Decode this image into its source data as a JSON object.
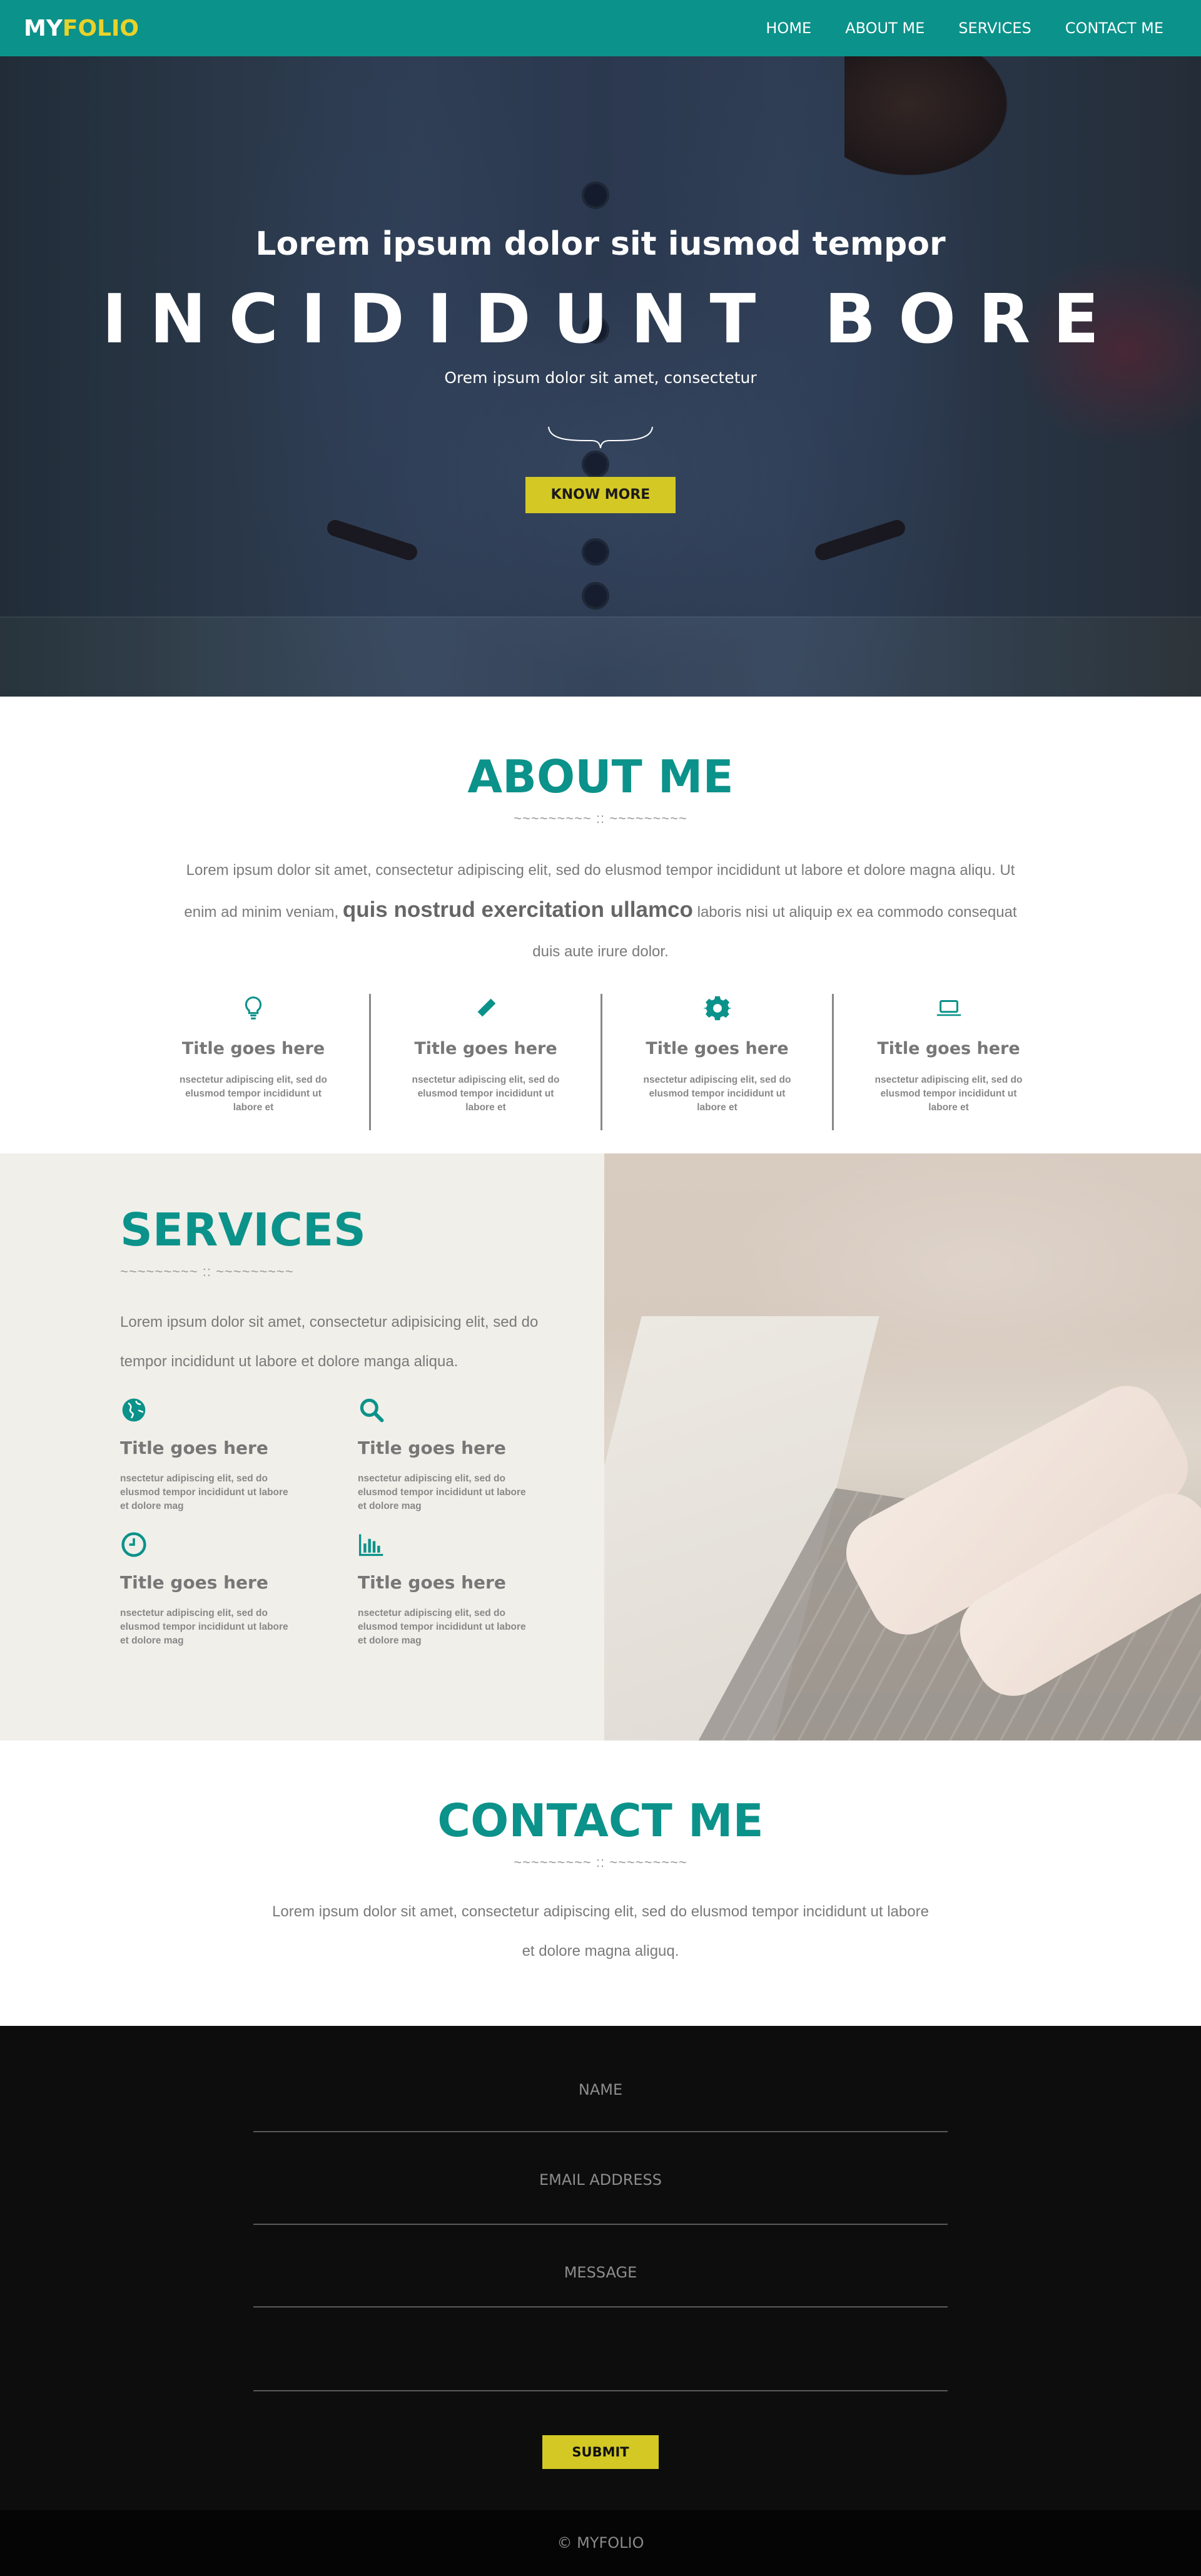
{
  "nav": {
    "brand_primary": "MY",
    "brand_accent": "FOLIO",
    "links": [
      "HOME",
      "ABOUT ME",
      "SERVICES",
      "CONTACT ME"
    ]
  },
  "hero": {
    "subtitle": "Lorem ipsum dolor sit iusmod tempor",
    "title": "INCIDIDUNT BORE",
    "tagline": "Orem ipsum dolor sit amet, consectetur",
    "button": "KNOW MORE"
  },
  "about": {
    "title": "ABOUT ME",
    "divider": "~~~~~~~~~ :: ~~~~~~~~~",
    "text_before": "Lorem ipsum dolor sit amet, consectetur adipiscing elit, sed do elusmod tempor incididunt ut labore et dolore magna aliqu. Ut enim ad minim veniam, ",
    "text_bold": "quis nostrud exercitation ullamco",
    "text_after": " laboris nisi ut aliquip ex ea commodo consequat duis aute irure dolor.",
    "features": [
      {
        "icon": "lightbulb-icon",
        "title": "Title goes here",
        "text": "nsectetur adipiscing elit, sed do elusmod tempor incididunt ut labore et"
      },
      {
        "icon": "pencil-icon",
        "title": "Title goes here",
        "text": "nsectetur adipiscing elit, sed do elusmod tempor incididunt ut labore et"
      },
      {
        "icon": "gear-icon",
        "title": "Title goes here",
        "text": "nsectetur adipiscing elit, sed do elusmod tempor incididunt ut labore et"
      },
      {
        "icon": "laptop-icon",
        "title": "Title goes here",
        "text": "nsectetur adipiscing elit, sed do elusmod tempor incididunt ut labore et"
      }
    ]
  },
  "services": {
    "title": "SERVICES",
    "divider": "~~~~~~~~~ :: ~~~~~~~~~",
    "text": "Lorem ipsum dolor sit amet, consectetur adipisicing elit, sed do tempor incididunt ut labore et dolore manga aliqua.",
    "items": [
      {
        "icon": "globe-icon",
        "title": "Title goes here",
        "text": "nsectetur adipiscing elit, sed do elusmod tempor incididunt ut labore et dolore mag"
      },
      {
        "icon": "search-icon",
        "title": "Title goes here",
        "text": "nsectetur adipiscing elit, sed do elusmod tempor incididunt ut labore et dolore mag"
      },
      {
        "icon": "clock-icon",
        "title": "Title goes here",
        "text": "nsectetur adipiscing elit, sed do elusmod tempor incididunt ut labore et dolore mag"
      },
      {
        "icon": "bar-chart-icon",
        "title": "Title goes here",
        "text": "nsectetur adipiscing elit, sed do elusmod tempor incididunt ut labore et dolore mag"
      }
    ]
  },
  "contact": {
    "title": "CONTACT ME",
    "divider": "~~~~~~~~~ :: ~~~~~~~~~",
    "text": "Lorem ipsum dolor sit amet, consectetur adipiscing elit, sed do elusmod tempor incididunt ut labore et dolore magna aliguq."
  },
  "form": {
    "name_placeholder": "NAME",
    "email_placeholder": "EMAIL ADDRESS",
    "message_placeholder": "MESSAGE",
    "submit": "SUBMIT"
  },
  "footer": {
    "text": "© MYFOLIO"
  },
  "colors": {
    "primary": "#0b928a",
    "accent": "#d4c825",
    "dark": "#0d0d0d"
  }
}
